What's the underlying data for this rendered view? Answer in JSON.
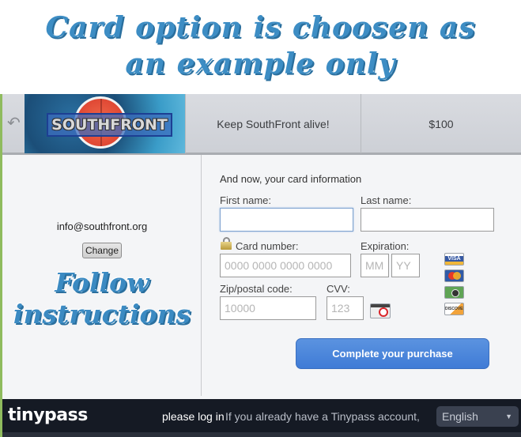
{
  "overlay": {
    "headline_line1": "Card option is choosen as",
    "headline_line2": "an example only",
    "instruction_line1": "Follow",
    "instruction_line2": "instructions"
  },
  "banner": {
    "back_icon": "back-arrow-icon",
    "logo_text": "SOUTHFRONT",
    "item_title": "Keep SouthFront alive!",
    "price": "$100"
  },
  "account": {
    "email": "info@southfront.org",
    "change_label": "Change"
  },
  "form": {
    "title": "And now, your card information",
    "first_name": {
      "label": "First name:",
      "value": "",
      "placeholder": ""
    },
    "last_name": {
      "label": "Last name:",
      "value": "",
      "placeholder": ""
    },
    "card_number": {
      "label": "Card number:",
      "value": "",
      "placeholder": "0000 0000 0000 0000"
    },
    "expiration": {
      "label": "Expiration:",
      "month_placeholder": "MM",
      "year_placeholder": "YY"
    },
    "zip": {
      "label": "Zip/postal code:",
      "value": "",
      "placeholder": "10000"
    },
    "cvv": {
      "label": "CVV:",
      "value": "",
      "placeholder": "123"
    },
    "card_logos": [
      {
        "name": "visa",
        "label": "VISA"
      },
      {
        "name": "mastercard",
        "label": ""
      },
      {
        "name": "amex",
        "label": ""
      },
      {
        "name": "discover",
        "label": "DISCOVER"
      }
    ],
    "submit_label": "Complete your purchase"
  },
  "footer": {
    "brand": "tinypass",
    "login_link": "please log in",
    "login_text": "If you already have a Tinypass account,",
    "language": "English"
  },
  "colors": {
    "accent_blue": "#4a86dc",
    "footer_bg": "#151a24",
    "overlay_text": "#3d8dc4"
  }
}
